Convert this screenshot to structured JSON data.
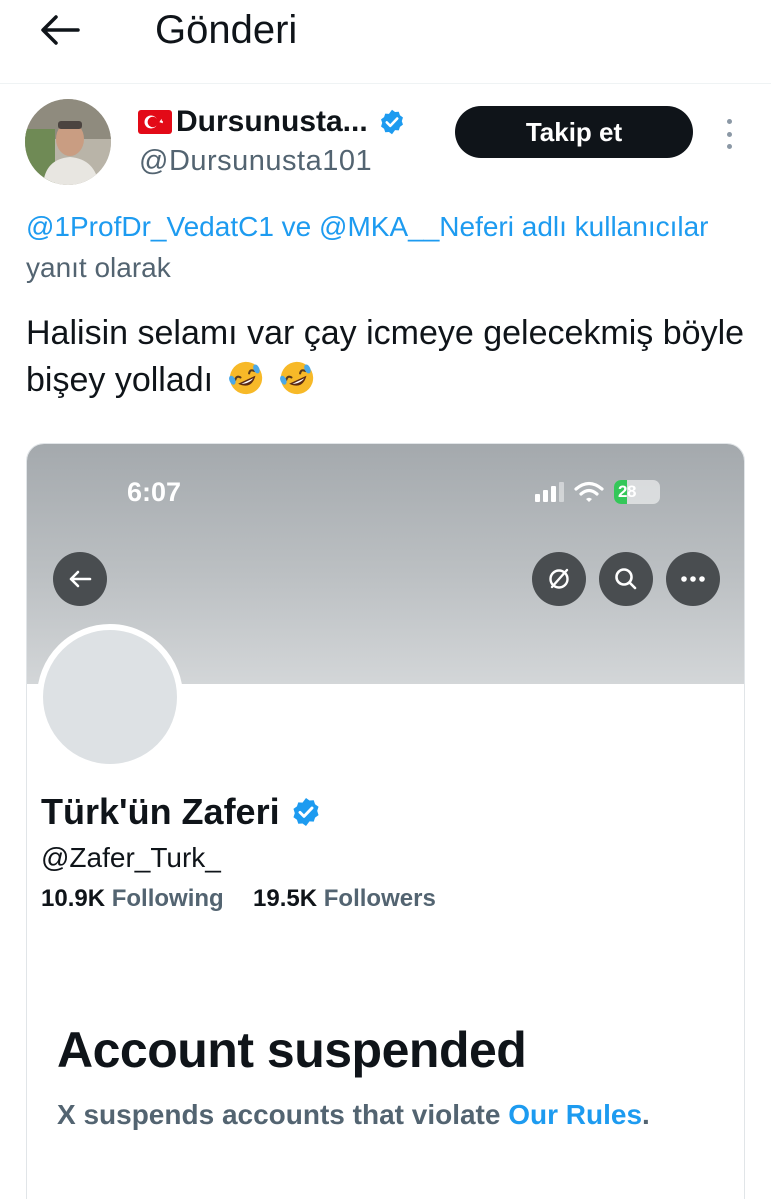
{
  "header": {
    "title": "Gönderi"
  },
  "author": {
    "name": "Dursunusta...",
    "flag": "turkey-flag-emoji",
    "verified": true,
    "handle": "@Dursunusta101",
    "follow_label": "Takip et"
  },
  "reply_context": {
    "mention_1": "@1ProfDr_VedatC1",
    "joiner": " ve ",
    "mention_2": "@MKA__Neferi",
    "suffix": " adlı kullanıcılar",
    "line2": "yanıt olarak"
  },
  "tweet": {
    "text": "Halisin selamı var çay icmeye gelecekmiş böyle bişey yolladı",
    "emojis": [
      "rolling-on-floor-laughing-emoji",
      "rolling-on-floor-laughing-emoji"
    ]
  },
  "embedded": {
    "status_time": "6:07",
    "battery": "28",
    "battery_level": 0.28,
    "profile_name": "Türk'ün Zaferi",
    "profile_handle": "@Zafer_Turk_",
    "following_count": "10.9K",
    "following_label": "Following",
    "followers_count": "19.5K",
    "followers_label": "Followers",
    "suspended_title": "Account suspended",
    "suspended_text": "X suspends accounts that violate ",
    "rules_link": "Our Rules",
    "rules_period": "."
  },
  "colors": {
    "accent": "#1d9bf0",
    "text_primary": "#0f1419",
    "text_secondary": "#536471",
    "button_dark": "#0f1419"
  }
}
